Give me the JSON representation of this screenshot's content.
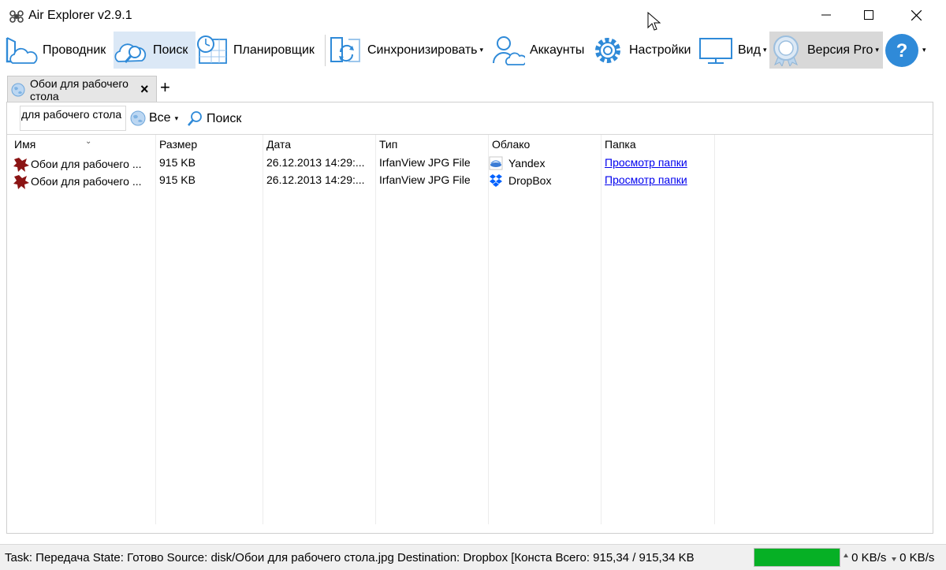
{
  "window": {
    "title": "Air Explorer v2.9.1"
  },
  "toolbar": {
    "explorer": "Проводник",
    "search": "Поиск",
    "scheduler": "Планировщик",
    "sync": "Синхронизировать",
    "accounts": "Аккаунты",
    "settings": "Настройки",
    "view": "Вид",
    "pro": "Версия Pro",
    "help_arrow": "·"
  },
  "tabs": [
    {
      "label": "Обои для рабочего стола"
    }
  ],
  "tab_add": "+",
  "tab_close": "×",
  "searchbar": {
    "query": "для рабочего стола",
    "scope": "Все",
    "search_button": "Поиск"
  },
  "columns": {
    "name": "Имя",
    "size": "Размер",
    "date": "Дата",
    "type": "Тип",
    "cloud": "Облако",
    "folder": "Папка"
  },
  "rows": [
    {
      "name": "Обои для рабочего ...",
      "size": "915 KB",
      "date": "26.12.2013 14:29:...",
      "type": "IrfanView JPG File",
      "cloud": "Yandex",
      "cloud_icon": "yandex-disk-icon",
      "folder": "Просмотр папки"
    },
    {
      "name": "Обои для рабочего ...",
      "size": "915 KB",
      "date": "26.12.2013 14:29:...",
      "type": "IrfanView JPG File",
      "cloud": "DropBox",
      "cloud_icon": "dropbox-icon",
      "folder": "Просмотр папки"
    }
  ],
  "status": {
    "text": "Task: Передача State: Готово Source: disk/Обои для рабочего стола.jpg Destination: Dropbox [Конста Всего: 915,34 / 915,34 KB",
    "progress_percent": 100,
    "upload_speed": "0 KB/s",
    "download_speed": "0 KB/s"
  },
  "colors": {
    "accent": "#2f8ad8",
    "progress": "#06b025",
    "link": "#0000ee"
  }
}
